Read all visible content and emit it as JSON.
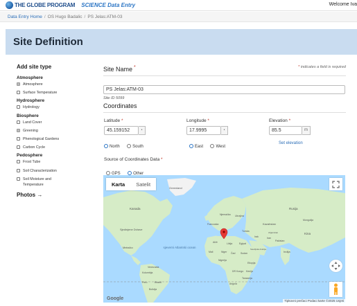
{
  "header": {
    "logo_text": "THE GLOBE PROGRAM",
    "app_name": "SCIENCE Data Entry",
    "welcome": "Welcome Iva"
  },
  "breadcrumb": [
    "Data Entry Home",
    "OS Hugo Badalic",
    "PS Jelas:ATM-03"
  ],
  "page_title": "Site Definition",
  "sidebar": {
    "title": "Add site type",
    "categories": [
      {
        "name": "Atmosphere",
        "items": [
          {
            "label": "Atmosphere",
            "checked": true
          },
          {
            "label": "Surface Temperature",
            "checked": false
          }
        ]
      },
      {
        "name": "Hydrosphere",
        "items": [
          {
            "label": "Hydrology",
            "checked": false
          }
        ]
      },
      {
        "name": "Biosphere",
        "items": [
          {
            "label": "Land Cover",
            "checked": false
          },
          {
            "label": "Greening",
            "checked": true
          },
          {
            "label": "Phenological Gardens",
            "checked": false
          },
          {
            "label": "Carbon Cycle",
            "checked": false
          }
        ]
      },
      {
        "name": "Pedosphere",
        "items": [
          {
            "label": "Frost Tube",
            "checked": false
          },
          {
            "label": "Soil Characterization",
            "checked": false
          },
          {
            "label": "Soil Moisture and Temperature",
            "checked": false
          }
        ]
      }
    ],
    "photos": "Photos →"
  },
  "site_name": {
    "label": "Site Name",
    "required_note": "indicates a field is required",
    "value": "PS Jelas:ATM-03",
    "site_id": "Site ID 5099"
  },
  "coordinates": {
    "title": "Coordinates",
    "latitude_label": "Latitude",
    "latitude_value": "45.159152",
    "longitude_label": "Longitude",
    "longitude_value": "17.9995",
    "elevation_label": "Elevation",
    "elevation_value": "85.5",
    "elevation_unit": "m",
    "north": "North",
    "south": "South",
    "east": "East",
    "west": "West",
    "set_elevation": "Set elevation",
    "source_label": "Source of Coordinates Data",
    "gps": "GPS",
    "other": "Other"
  },
  "map": {
    "tab_map": "Karta",
    "tab_satellite": "Satelit",
    "ocean_label": "sjeverni Atlantski ocean",
    "labels": [
      "Greenland",
      "Rusija",
      "Kanada",
      "Kazahstan",
      "Sjedinjene Države",
      "Meksiko",
      "Venezuela",
      "Kolumbija",
      "Peru",
      "Brazil",
      "Bolivija",
      "Alžir",
      "Libija",
      "Egipat",
      "Mali",
      "Niger",
      "Čad",
      "Sudan",
      "Nigerija",
      "Etiopija",
      "DR Kongo",
      "Kenija",
      "Tanzanija",
      "Angola",
      "Iran",
      "Indija",
      "Kina",
      "Mongolija",
      "Saudijska Arabija",
      "Njemačka",
      "Francuska",
      "Ukrajina",
      "Turska",
      "Irak",
      "Pakistan",
      "Afganistan"
    ],
    "google": "Google",
    "attribution": "Tipkovni prečaci   Podaci karte ©2025   Uvjeti"
  },
  "colors": {
    "banner": "#c9dcf0",
    "accent": "#2a74c4",
    "required": "#c0392b",
    "water": "#aadaff",
    "land": "#d6ecc7"
  }
}
